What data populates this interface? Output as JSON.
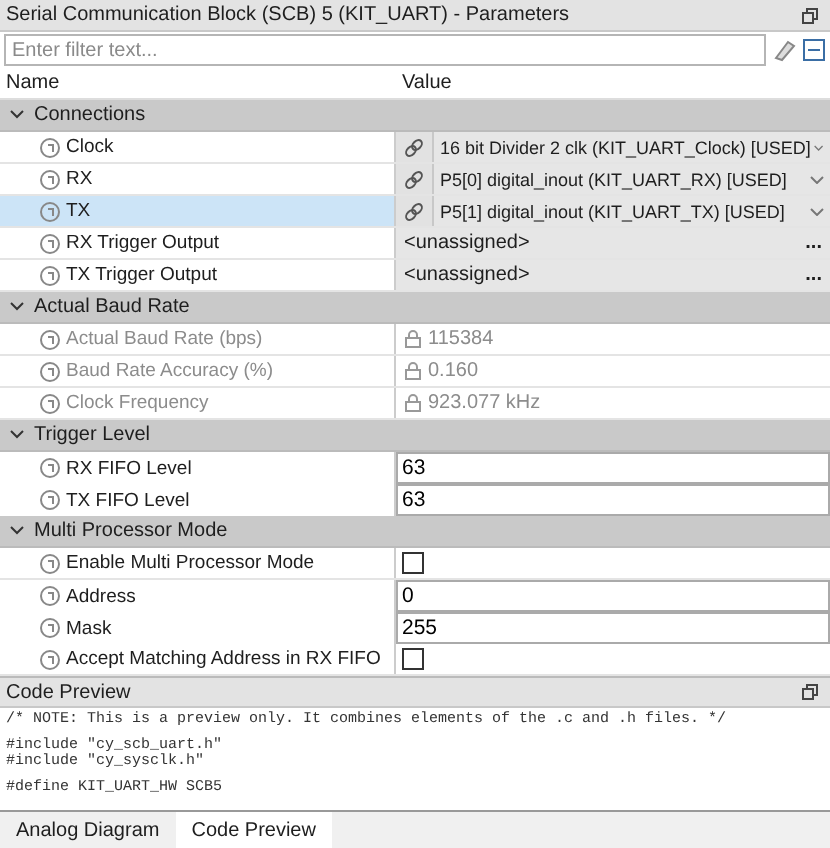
{
  "panel": {
    "title": "Serial Communication Block (SCB) 5 (KIT_UART) - Parameters"
  },
  "filter": {
    "placeholder": "Enter filter text..."
  },
  "columns": [
    "Name",
    "Value"
  ],
  "groups": [
    {
      "label": "Connections",
      "expanded": true,
      "rows": [
        {
          "name": "Clock",
          "kind": "link",
          "value": "16 bit Divider 2 clk (KIT_UART_Clock) [USED]",
          "selected": false
        },
        {
          "name": "RX",
          "kind": "link",
          "value": "P5[0] digital_inout (KIT_UART_RX) [USED]",
          "selected": false
        },
        {
          "name": "TX",
          "kind": "link",
          "value": "P5[1] digital_inout (KIT_UART_TX) [USED]",
          "selected": true
        },
        {
          "name": "RX Trigger Output",
          "kind": "picker",
          "value": "<unassigned>",
          "button": "...",
          "selected": false
        },
        {
          "name": "TX Trigger Output",
          "kind": "picker",
          "value": "<unassigned>",
          "button": "...",
          "selected": false
        }
      ]
    },
    {
      "label": "Actual Baud Rate",
      "expanded": true,
      "rows": [
        {
          "name": "Actual Baud Rate (bps)",
          "kind": "readonly",
          "value": "115384",
          "selected": false
        },
        {
          "name": "Baud Rate Accuracy (%)",
          "kind": "readonly",
          "value": "0.160",
          "selected": false
        },
        {
          "name": "Clock Frequency",
          "kind": "readonly",
          "value": "923.077 kHz",
          "selected": false
        }
      ]
    },
    {
      "label": "Trigger Level",
      "expanded": true,
      "rows": [
        {
          "name": "RX FIFO Level",
          "kind": "text",
          "value": "63",
          "selected": false
        },
        {
          "name": "TX FIFO Level",
          "kind": "text",
          "value": "63",
          "selected": false
        }
      ]
    },
    {
      "label": "Multi Processor Mode",
      "expanded": true,
      "rows": [
        {
          "name": "Enable Multi Processor Mode",
          "kind": "checkbox",
          "checked": false,
          "selected": false
        },
        {
          "name": "Address",
          "kind": "text",
          "value": "0",
          "selected": false
        },
        {
          "name": "Mask",
          "kind": "text",
          "value": "255",
          "selected": false
        },
        {
          "name": "Accept Matching Address in RX FIFO",
          "kind": "checkbox",
          "checked": false,
          "selected": false
        }
      ]
    }
  ],
  "code_preview": {
    "title": "Code Preview",
    "blocks": [
      [
        "/* NOTE: This is a preview only. It combines elements of the .c and .h files. */"
      ],
      [
        "#include \"cy_scb_uart.h\"",
        "#include \"cy_sysclk.h\""
      ],
      [
        "#define KIT_UART_HW SCB5"
      ]
    ]
  },
  "tabs": [
    {
      "label": "Analog Diagram",
      "selected": false
    },
    {
      "label": "Code Preview",
      "selected": true
    }
  ]
}
